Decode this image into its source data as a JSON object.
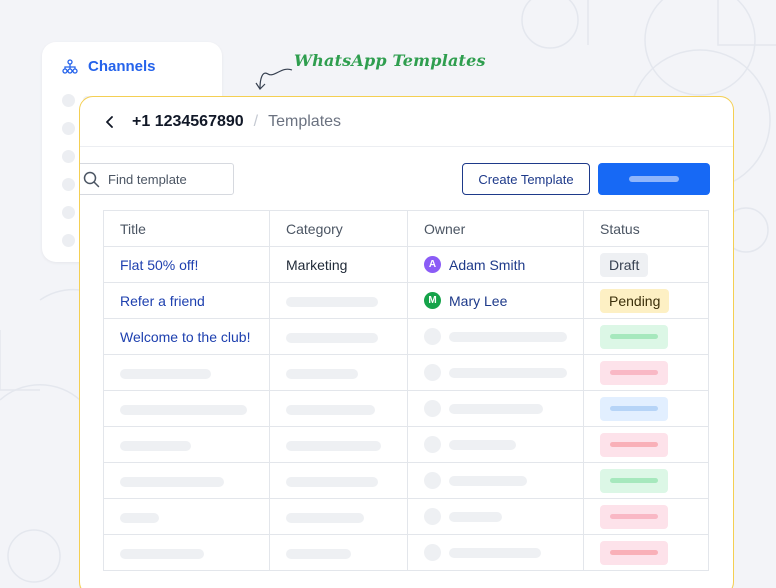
{
  "channels": {
    "label": "Channels",
    "placeholder_rows": 6
  },
  "annotation": "WhatsApp Templates",
  "breadcrumb": {
    "phone": "+1 1234567890",
    "separator": "/",
    "current": "Templates"
  },
  "search": {
    "placeholder": "Find template"
  },
  "buttons": {
    "create_label": "Create Template"
  },
  "table": {
    "headers": {
      "title": "Title",
      "category": "Category",
      "owner": "Owner",
      "status": "Status"
    },
    "rows": [
      {
        "title": "Flat 50% off!",
        "category": "Marketing",
        "owner": {
          "name": "Adam Smith",
          "initial": "A",
          "color": "#8b5cf6"
        },
        "status": {
          "label": "Draft",
          "bg": "#eef0f3",
          "fg": "#374151"
        }
      },
      {
        "title": "Refer a friend",
        "category": "",
        "owner": {
          "name": "Mary Lee",
          "initial": "M",
          "color": "#16a34a"
        },
        "status": {
          "label": "Pending",
          "bg": "#fdf0c4",
          "fg": "#3b2f0a"
        }
      },
      {
        "title": "Welcome to the club!",
        "category": "",
        "owner": null,
        "status": {
          "label": "",
          "bg": "#dcf7e6",
          "fg": "#a6e8bd"
        }
      }
    ],
    "skeleton_rows": [
      {
        "status_bg": "#fde2ea",
        "status_fg": "#f9b8c5"
      },
      {
        "status_bg": "#e2efff",
        "status_fg": "#b6d4f7"
      },
      {
        "status_bg": "#fde2ea",
        "status_fg": "#f9b0b8"
      },
      {
        "status_bg": "#dcf7e6",
        "status_fg": "#a6e8bd"
      },
      {
        "status_bg": "#fde2ea",
        "status_fg": "#f9b8c5"
      },
      {
        "status_bg": "#fde2ea",
        "status_fg": "#f9b0b8"
      }
    ]
  },
  "colors": {
    "accent": "#2563eb",
    "primary_button": "#1769f5",
    "panel_border": "#f4cf53",
    "annotation": "#2f9e4f",
    "link": "#1e40af"
  },
  "icons": {
    "channels": "sitemap-icon",
    "back": "chevron-left-icon",
    "search": "search-icon",
    "annotation_arrow": "curved-arrow-icon"
  }
}
